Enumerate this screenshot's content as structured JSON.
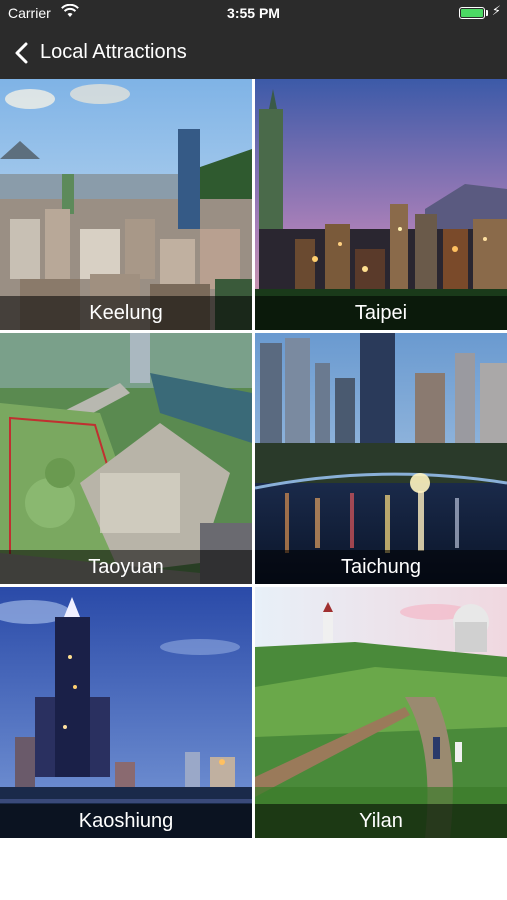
{
  "status_bar": {
    "carrier": "Carrier",
    "time": "3:55 PM",
    "battery_level": 1.0,
    "icons": [
      "wifi-icon",
      "battery-icon",
      "charging-bolt-icon"
    ]
  },
  "nav": {
    "back_icon": "chevron-left-icon",
    "title": "Local Attractions"
  },
  "attractions": [
    {
      "label": "Keelung"
    },
    {
      "label": "Taipei"
    },
    {
      "label": "Taoyuan"
    },
    {
      "label": "Taichung"
    },
    {
      "label": "Kaoshiung"
    },
    {
      "label": "Yilan"
    }
  ],
  "colors": {
    "bar_background": "#2b2b2b",
    "battery_green": "#4cd964",
    "caption_overlay": "rgba(0,0,0,0.55)"
  }
}
